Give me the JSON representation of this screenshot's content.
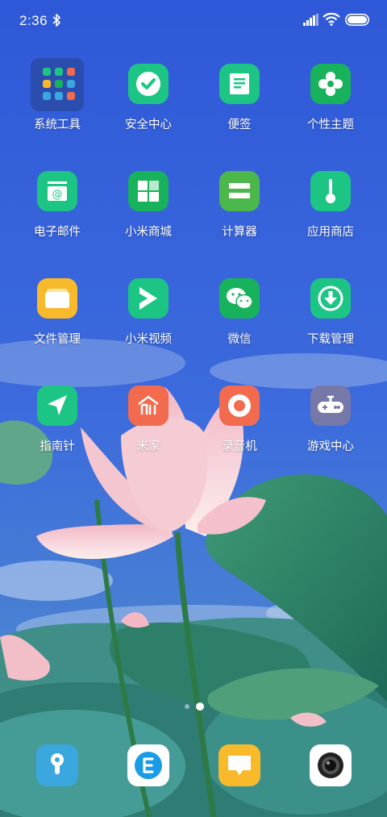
{
  "status_bar": {
    "time": "2:36"
  },
  "home": {
    "apps": [
      {
        "label": "系统工具",
        "icon": "folder-icon"
      },
      {
        "label": "安全中心",
        "icon": "checkmark-shield-icon",
        "color": "#1CC584"
      },
      {
        "label": "便签",
        "icon": "note-icon",
        "color": "#1CC584"
      },
      {
        "label": "个性主题",
        "icon": "flower-icon",
        "color": "#18B25C"
      },
      {
        "label": "电子邮件",
        "icon": "email-icon",
        "color": "#1CC584"
      },
      {
        "label": "小米商城",
        "icon": "store-grid-icon",
        "color": "#18B25C"
      },
      {
        "label": "计算器",
        "icon": "equals-icon",
        "color": "#4CB84C"
      },
      {
        "label": "应用商店",
        "icon": "thermometer-icon",
        "color": "#1CC584"
      },
      {
        "label": "文件管理",
        "icon": "file-folder-icon",
        "color": "#F8B92B"
      },
      {
        "label": "小米视频",
        "icon": "video-play-icon",
        "color": "#1CC584"
      },
      {
        "label": "微信",
        "icon": "wechat-icon",
        "color": "#18B25C"
      },
      {
        "label": "下载管理",
        "icon": "download-icon",
        "color": "#1CC584"
      },
      {
        "label": "指南针",
        "icon": "compass-arrow-icon",
        "color": "#1CC584"
      },
      {
        "label": "米家",
        "icon": "mi-home-icon",
        "color": "#F26B4E"
      },
      {
        "label": "录音机",
        "icon": "record-icon",
        "color": "#F26B4E"
      },
      {
        "label": "游戏中心",
        "icon": "gamepad-icon",
        "color": "#7678A8"
      }
    ]
  },
  "page_indicator": {
    "pages": 2,
    "current": 2
  },
  "dock": {
    "apps": [
      {
        "icon": "phone-keyhole-icon",
        "color": "#3BA7DF"
      },
      {
        "icon": "browser-e-icon",
        "color": "#FFFFFF"
      },
      {
        "icon": "message-icon",
        "color": "#F8B92B"
      },
      {
        "icon": "camera-icon",
        "color": "#FFFFFF"
      }
    ]
  }
}
